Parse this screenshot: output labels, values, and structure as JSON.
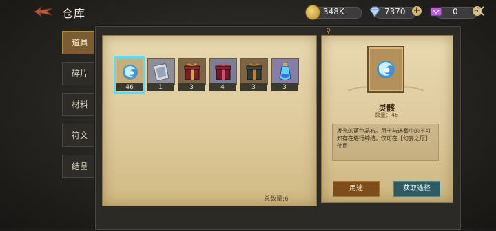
{
  "header": {
    "title": "仓库"
  },
  "resources": [
    {
      "icon": "gold-coin-icon",
      "value": "348K",
      "color": "#d9b23c"
    },
    {
      "icon": "diamond-icon",
      "value": "7370",
      "color": "#9ec5f2"
    },
    {
      "icon": "purple-ticket-icon",
      "value": "0",
      "color": "#b04fd6"
    }
  ],
  "tabs": [
    {
      "label": "道具",
      "active": true
    },
    {
      "label": "碎片",
      "active": false
    },
    {
      "label": "材料",
      "active": false
    },
    {
      "label": "符文",
      "active": false
    },
    {
      "label": "结晶",
      "active": false
    }
  ],
  "items": [
    {
      "icon": "blue-crystal-icon",
      "count": "46",
      "bg": "#c9ae78"
    },
    {
      "icon": "silver-scroll-icon",
      "count": "1",
      "bg": "#8e8e99"
    },
    {
      "icon": "gift-box-red-icon",
      "count": "3",
      "bg": "#7e6447"
    },
    {
      "icon": "gift-box-crimson-icon",
      "count": "4",
      "bg": "#7a7f97"
    },
    {
      "icon": "gift-box-teal-icon",
      "count": "3",
      "bg": "#7e6447"
    },
    {
      "icon": "potion-bottle-icon",
      "count": "3",
      "bg": "#857fa8"
    }
  ],
  "footer": {
    "total_label": "总数量:6"
  },
  "detail": {
    "icon": "blue-crystal-icon",
    "name": "灵骸",
    "quantity_label": "数量：46",
    "description": "发光的蓝色晶石。用于与迷雾中的不可知存在进行缔结。仅可在【幻妄之厅】使用",
    "use_label": "用途",
    "obtain_label": "获取途径"
  },
  "colors": {
    "accent": "#4fe0ff",
    "gold": "#b08a4a"
  }
}
